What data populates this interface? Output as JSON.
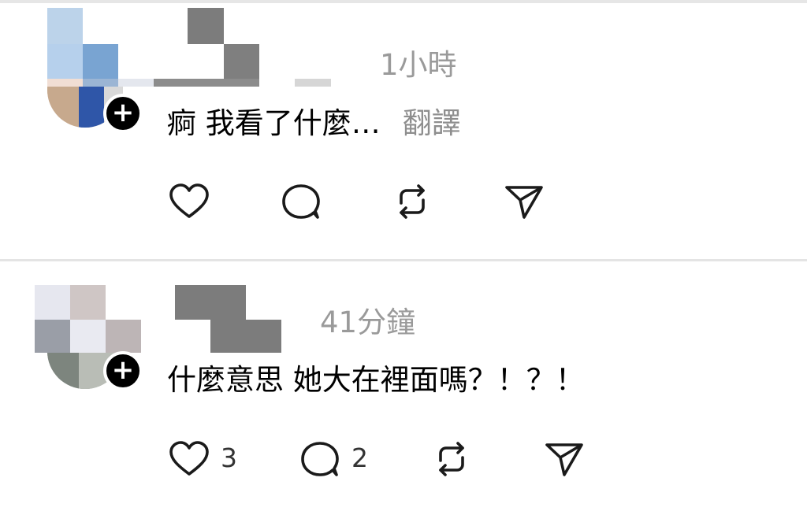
{
  "posts": [
    {
      "time": "1小時",
      "text": "痾 我看了什麼…",
      "translate_label": "翻譯",
      "actions": {
        "like_count": null,
        "reply_count": null
      }
    },
    {
      "time": "41分鐘",
      "text": "什麼意思 她大在裡面嗎？！？！",
      "actions": {
        "like_count": "3",
        "reply_count": "2"
      }
    }
  ],
  "icons": {
    "like": "heart-icon",
    "reply": "comment-bubble-icon",
    "repost": "repost-icon",
    "share": "send-icon",
    "follow": "plus-icon"
  },
  "colors": {
    "text": "#000000",
    "meta": "#9a9a9a",
    "icon": "#1a1a1a",
    "divider": "#e4e4e4"
  }
}
